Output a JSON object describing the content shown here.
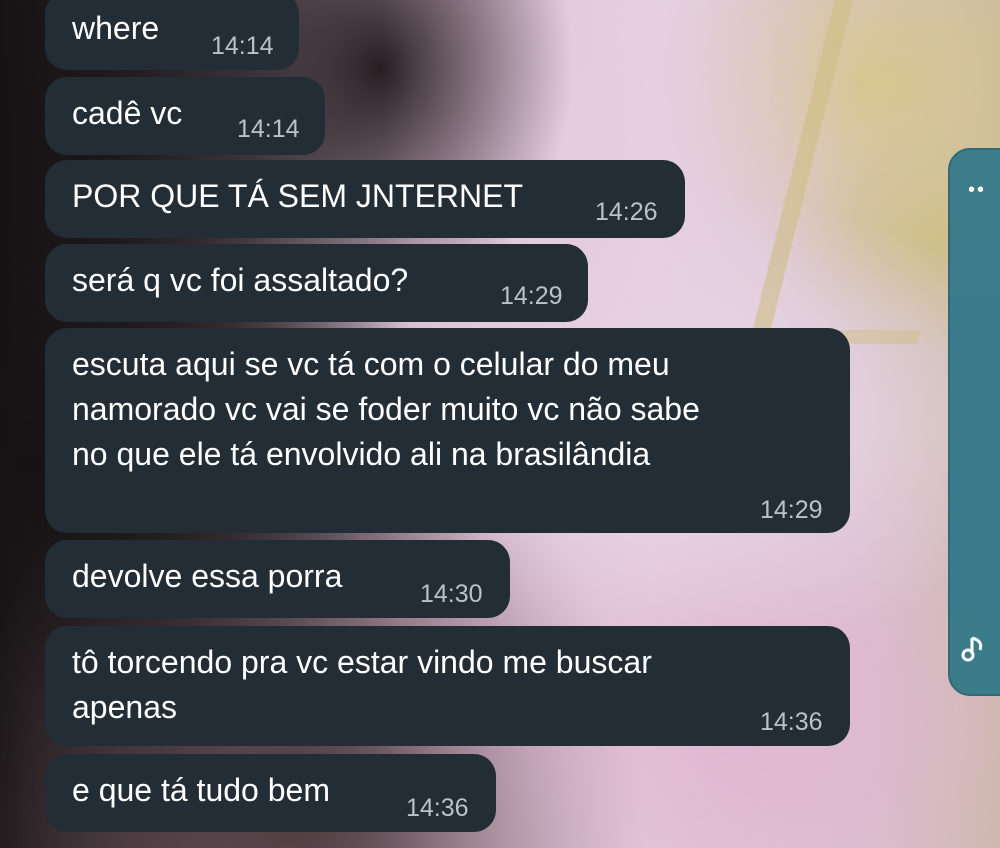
{
  "side_widget": {
    "dots": "••"
  },
  "messages": [
    {
      "text": "where",
      "time": "14:14"
    },
    {
      "text": "cadê vc",
      "time": "14:14"
    },
    {
      "text": "POR QUE TÁ SEM JNTERNET",
      "time": "14:26"
    },
    {
      "text": "será q vc foi assaltado?",
      "time": "14:29"
    },
    {
      "text": "escuta aqui se vc tá com o celular do meu\nnamorado vc vai se foder muito vc não sabe\nno que ele tá envolvido ali na brasilândia",
      "time": "14:29"
    },
    {
      "text": "devolve essa porra",
      "time": "14:30"
    },
    {
      "text": "tô torcendo pra vc estar vindo me buscar\napenas",
      "time": "14:36"
    },
    {
      "text": "e que tá tudo bem",
      "time": "14:36"
    }
  ]
}
